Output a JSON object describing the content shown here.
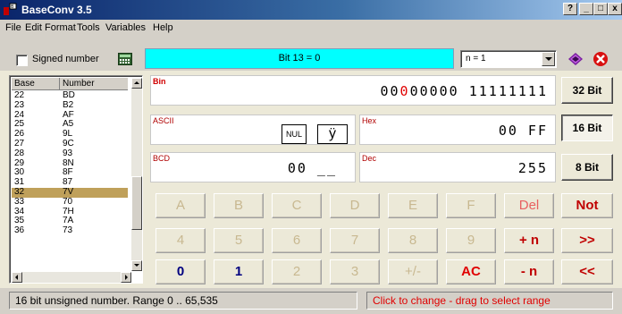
{
  "window": {
    "title": "BaseConv 3.5",
    "controls": {
      "help": "?",
      "minimize": "_",
      "maximize": "□",
      "close": "x"
    }
  },
  "menu": [
    "File",
    "Edit",
    "Format",
    "Tools",
    "Variables",
    "Help"
  ],
  "toolbar": {
    "signed_label": "Signed number",
    "signed_checked": false,
    "bit_status": "Bit 13  =  0",
    "n_select_value": "n = 1",
    "icons": [
      "calculator-icon",
      "book-icon",
      "close-red-icon"
    ]
  },
  "base_list": {
    "headers": [
      "Base",
      "Number"
    ],
    "rows": [
      [
        "22",
        "BD"
      ],
      [
        "23",
        "B2"
      ],
      [
        "24",
        "AF"
      ],
      [
        "25",
        "A5"
      ],
      [
        "26",
        "9L"
      ],
      [
        "27",
        "9C"
      ],
      [
        "28",
        "93"
      ],
      [
        "29",
        "8N"
      ],
      [
        "30",
        "8F"
      ],
      [
        "31",
        "87"
      ],
      [
        "32",
        "7V"
      ],
      [
        "33",
        "70"
      ],
      [
        "34",
        "7H"
      ],
      [
        "35",
        "7A"
      ],
      [
        "36",
        "73"
      ]
    ],
    "selected_base": "32"
  },
  "fields": {
    "bin": {
      "label": "Bin",
      "value_prefix": "00",
      "value_red": "0",
      "value_rest": "00000  11111111"
    },
    "ascii": {
      "label": "ASCII",
      "char1": "NUL",
      "char2": "ÿ"
    },
    "hex": {
      "label": "Hex",
      "value": "00  FF"
    },
    "bcd": {
      "label": "BCD",
      "value": "00  __"
    },
    "dec": {
      "label": "Dec",
      "value": "255"
    }
  },
  "bit_buttons": [
    "32 Bit",
    "16 Bit",
    "8 Bit"
  ],
  "bit_selected": "16 Bit",
  "keypad": {
    "row1": [
      "A",
      "B",
      "C",
      "D",
      "E",
      "F",
      "Del",
      "Not"
    ],
    "row2": [
      "4",
      "5",
      "6",
      "7",
      "8",
      "9",
      "+ n",
      ">>"
    ],
    "row3": [
      "0",
      "1",
      "2",
      "3",
      "+/-",
      "AC",
      "- n",
      "<<"
    ]
  },
  "status": {
    "left": "16 bit unsigned number.   Range  0  ..  65,535",
    "right": "Click to change - drag to select range"
  },
  "colors": {
    "bit_bar": "#00ffff",
    "accent_red": "#e00000",
    "selected_row": "#bfa05a",
    "disabled_key": "#c8b890"
  }
}
